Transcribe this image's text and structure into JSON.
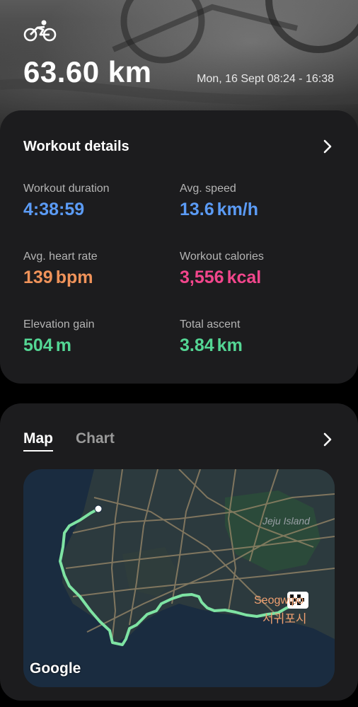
{
  "header": {
    "activity_icon": "cycling-icon",
    "distance": "63.60 km",
    "date_range": "Mon, 16 Sept 08:24 - 16:38"
  },
  "details": {
    "title": "Workout details",
    "stats": [
      {
        "label": "Workout duration",
        "value": "4:38:59",
        "unit": "",
        "color": "#5b9bf5"
      },
      {
        "label": "Avg. speed",
        "value": "13.6",
        "unit": "km/h",
        "color": "#5b9bf5"
      },
      {
        "label": "Avg. heart rate",
        "value": "139",
        "unit": "bpm",
        "color": "#f0935a"
      },
      {
        "label": "Workout calories",
        "value": "3,556",
        "unit": "kcal",
        "color": "#f2468c"
      },
      {
        "label": "Elevation gain",
        "value": "504",
        "unit": "m",
        "color": "#54d694"
      },
      {
        "label": "Total ascent",
        "value": "3.84",
        "unit": "km",
        "color": "#54d694"
      }
    ]
  },
  "map_card": {
    "tabs": [
      {
        "label": "Map",
        "active": true
      },
      {
        "label": "Chart",
        "active": false
      }
    ],
    "map": {
      "label_island": "Jeju Island",
      "label_city_en": "Seogwipo",
      "label_city_ko": "서귀포시",
      "attribution": "Google",
      "route_color": "#7ee3a3"
    }
  }
}
